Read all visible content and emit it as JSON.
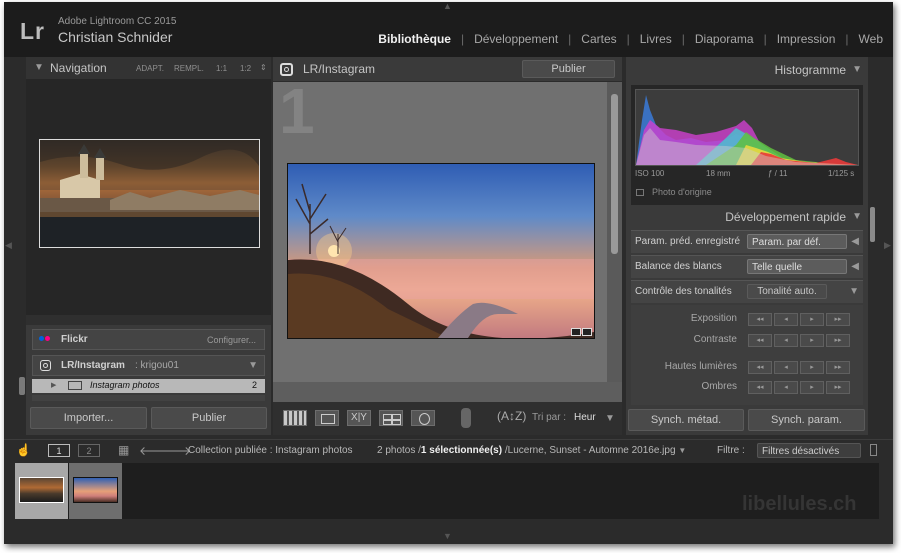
{
  "app": {
    "logo": "Lr",
    "version": "Adobe Lightroom CC 2015",
    "user": "Christian Schnider"
  },
  "modules": [
    "Bibliothèque",
    "Développement",
    "Cartes",
    "Livres",
    "Diaporama",
    "Impression",
    "Web"
  ],
  "active_module": "Bibliothèque",
  "navigator": {
    "title": "Navigation",
    "zoom_options": [
      "ADAPT.",
      "REMPL.",
      "1:1",
      "1:2"
    ]
  },
  "publish": {
    "flickr": {
      "label": "Flickr",
      "action": "Configurer..."
    },
    "instagram": {
      "label": "LR/Instagram",
      "account": ": krigou01"
    },
    "collection": {
      "label": "Instagram photos",
      "count": "2"
    },
    "import_label": "Importer...",
    "publish_label": "Publier"
  },
  "center": {
    "collection_title": "LR/Instagram",
    "publish_button": "Publier",
    "watermark_number": "1",
    "sort_label": "Tri par :",
    "sort_value": "Heur"
  },
  "histogram": {
    "title": "Histogramme",
    "iso": "ISO 100",
    "focal": "18 mm",
    "aperture": "ƒ / 11",
    "shutter": "1/125 s",
    "original": "Photo d'origine"
  },
  "quick_develop": {
    "title": "Développement rapide",
    "preset_label": "Param. préd. enregistré",
    "preset_value": "Param. par déf.",
    "wb_label": "Balance des blancs",
    "wb_value": "Telle quelle",
    "tone_label": "Contrôle des tonalités",
    "auto_tone": "Tonalité auto.",
    "rows": [
      "Exposition",
      "Contraste",
      "Hautes lumières",
      "Ombres"
    ],
    "step_labels": [
      "◂◂",
      "◂",
      "▸",
      "▸▸"
    ]
  },
  "sync": {
    "metadata": "Synch. métad.",
    "settings": "Synch. param."
  },
  "filmstrip": {
    "screen1": "1",
    "screen2": "2",
    "breadcrumb": "Collection publiée : Instagram photos",
    "count_prefix": "2 photos /",
    "selected": "1 sélectionnée(s)",
    "filename": " /Lucerne, Sunset - Automne 2016e.jpg",
    "filter_label": "Filtre :",
    "filter_value": "Filtres désactivés"
  },
  "watermark_site": "libellules.ch",
  "colors": {
    "background": "#2b2b2b",
    "accent_active": "#f0f0f0"
  }
}
